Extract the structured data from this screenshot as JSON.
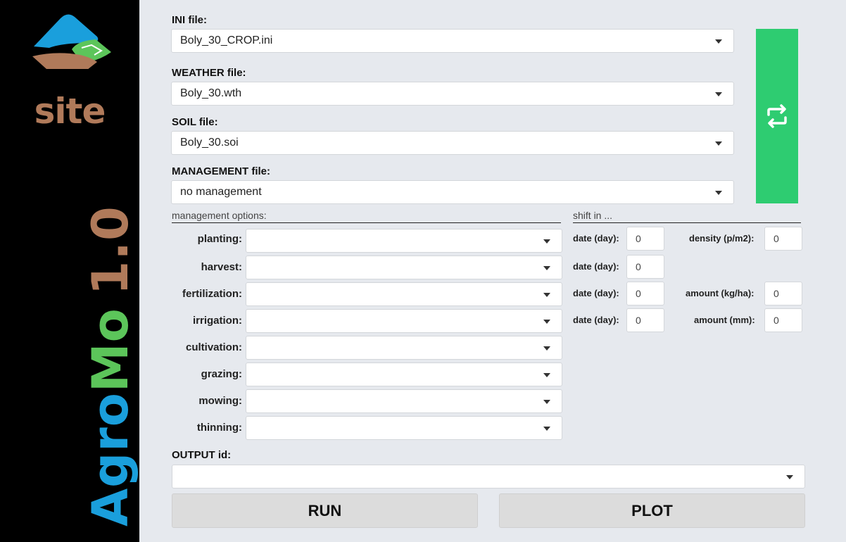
{
  "sidebar": {
    "site_text": "site",
    "brand_agro": "Agro",
    "brand_mo": "Mo",
    "brand_version": "1.0"
  },
  "files": {
    "ini": {
      "label": "INI file:",
      "value": "Boly_30_CROP.ini"
    },
    "weather": {
      "label": "WEATHER file:",
      "value": "Boly_30.wth"
    },
    "soil": {
      "label": "SOIL file:",
      "value": "Boly_30.soi"
    },
    "management": {
      "label": "MANAGEMENT file:",
      "value": "no management"
    }
  },
  "refresh_icon": "refresh-icon",
  "management_options": {
    "title": "management options:",
    "items": [
      {
        "label": "planting:",
        "value": ""
      },
      {
        "label": "harvest:",
        "value": ""
      },
      {
        "label": "fertilization:",
        "value": ""
      },
      {
        "label": "irrigation:",
        "value": ""
      },
      {
        "label": "cultivation:",
        "value": ""
      },
      {
        "label": "grazing:",
        "value": ""
      },
      {
        "label": "mowing:",
        "value": ""
      },
      {
        "label": "thinning:",
        "value": ""
      }
    ]
  },
  "shift": {
    "title": "shift in ...",
    "planting_date": {
      "label": "date (day):",
      "value": "0"
    },
    "planting_density": {
      "label": "density (p/m2):",
      "value": "0"
    },
    "harvest_date": {
      "label": "date (day):",
      "value": "0"
    },
    "fertilization_date": {
      "label": "date (day):",
      "value": "0"
    },
    "fertilization_amount": {
      "label": "amount (kg/ha):",
      "value": "0"
    },
    "irrigation_date": {
      "label": "date (day):",
      "value": "0"
    },
    "irrigation_amount": {
      "label": "amount (mm):",
      "value": "0"
    }
  },
  "output": {
    "label": "OUTPUT id:",
    "value": ""
  },
  "buttons": {
    "run": "RUN",
    "plot": "PLOT"
  },
  "colors": {
    "sidebar": "#000000",
    "refresh": "#2ecc71",
    "agro": "#1a9fdc",
    "mo": "#5cc55a",
    "site": "#b07a5a"
  }
}
